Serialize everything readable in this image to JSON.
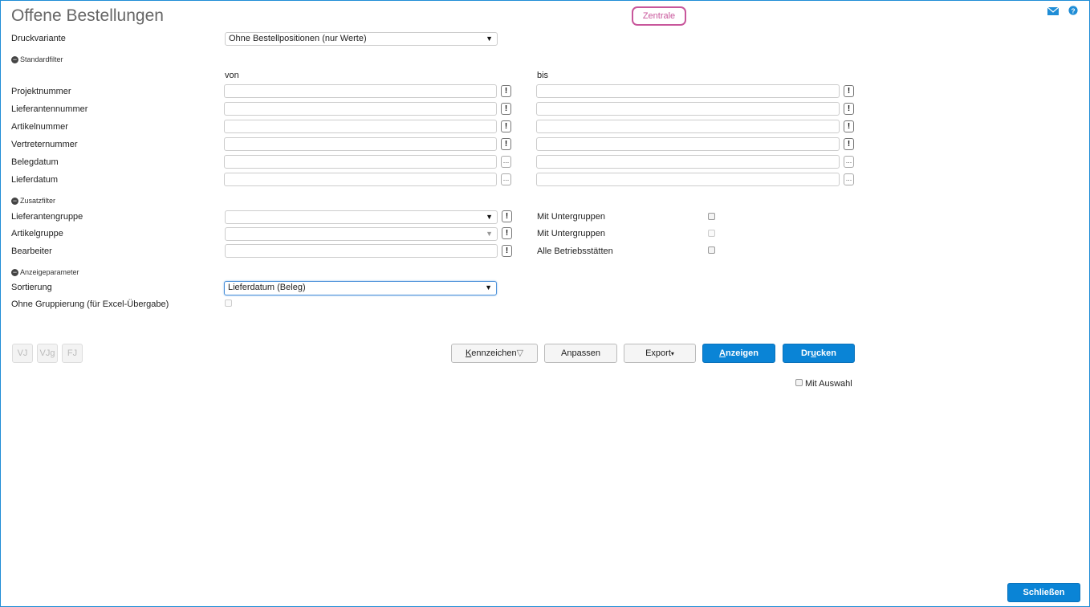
{
  "header": {
    "title": "Offene Bestellungen",
    "badge": "Zentrale",
    "icons": [
      "mail-icon",
      "help-icon"
    ]
  },
  "druckvariante": {
    "label": "Druckvariante",
    "value": "Ohne Bestellpositionen (nur Werte)"
  },
  "standardfilter": {
    "title": "Standardfilter",
    "von": "von",
    "bis": "bis",
    "rows": [
      {
        "label": "Projektnummer",
        "btn": "!"
      },
      {
        "label": "Lieferantennummer",
        "btn": "!"
      },
      {
        "label": "Artikelnummer",
        "btn": "!"
      },
      {
        "label": "Vertreternummer",
        "btn": "!"
      },
      {
        "label": "Belegdatum",
        "btn": "..."
      },
      {
        "label": "Lieferdatum",
        "btn": "..."
      }
    ]
  },
  "zusatzfilter": {
    "title": "Zusatzfilter",
    "lieferantengruppe": "Lieferantengruppe",
    "artikelgruppe": "Artikelgruppe",
    "bearbeiter": "Bearbeiter",
    "mit_untergruppen_1": "Mit Untergruppen",
    "mit_untergruppen_2": "Mit Untergruppen",
    "alle_betriebsstaetten": "Alle Betriebsstätten",
    "exc": "!"
  },
  "anzeigeparameter": {
    "title": "Anzeigeparameter",
    "sortierung_label": "Sortierung",
    "sortierung_value": "Lieferdatum (Beleg)",
    "ohne_gruppierung": "Ohne Gruppierung (für Excel-Übergabe)"
  },
  "small_buttons": [
    "VJ",
    "VJg",
    "FJ"
  ],
  "actions": {
    "kennzeichen_k": "K",
    "kennzeichen_rest": "ennzeichen",
    "anpassen": "Anpassen",
    "export": "Export",
    "anzeigen_a": "A",
    "anzeigen_rest": "nzeigen",
    "drucken_pre": "Dr",
    "drucken_u": "u",
    "drucken_rest": "cken"
  },
  "mit_auswahl": "Mit Auswahl",
  "schliessen": "Schließen"
}
